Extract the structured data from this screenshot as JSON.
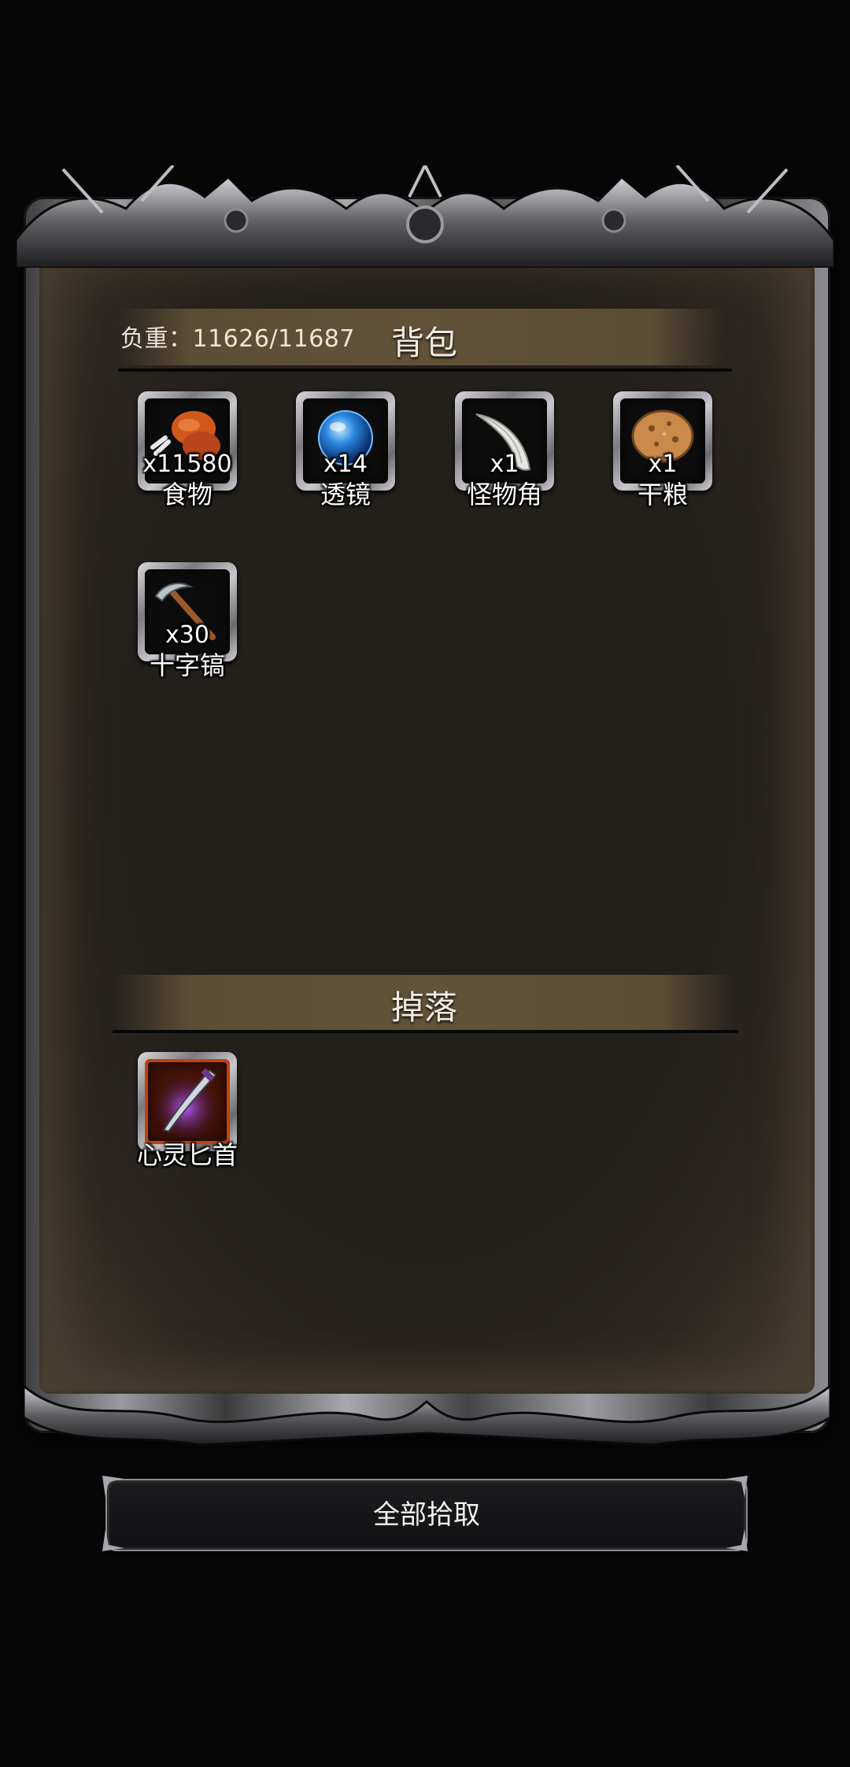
{
  "backpack": {
    "title": "背包",
    "weight_label": "负重：11626/11687",
    "items": [
      {
        "name": "食物",
        "qty": "x11580",
        "icon": "meat-icon"
      },
      {
        "name": "透镜",
        "qty": "x14",
        "icon": "lens-orb-icon"
      },
      {
        "name": "怪物角",
        "qty": "x1",
        "icon": "monster-horn-icon"
      },
      {
        "name": "干粮",
        "qty": "x1",
        "icon": "dry-bread-icon"
      },
      {
        "name": "十字镐",
        "qty": "x30",
        "icon": "pickaxe-icon"
      }
    ]
  },
  "drops": {
    "title": "掉落",
    "items": [
      {
        "name": "心灵匕首",
        "icon": "psychic-dagger-icon",
        "rarity_color": "#c2410c"
      }
    ]
  },
  "actions": {
    "pickup_all_label": "全部拾取"
  }
}
